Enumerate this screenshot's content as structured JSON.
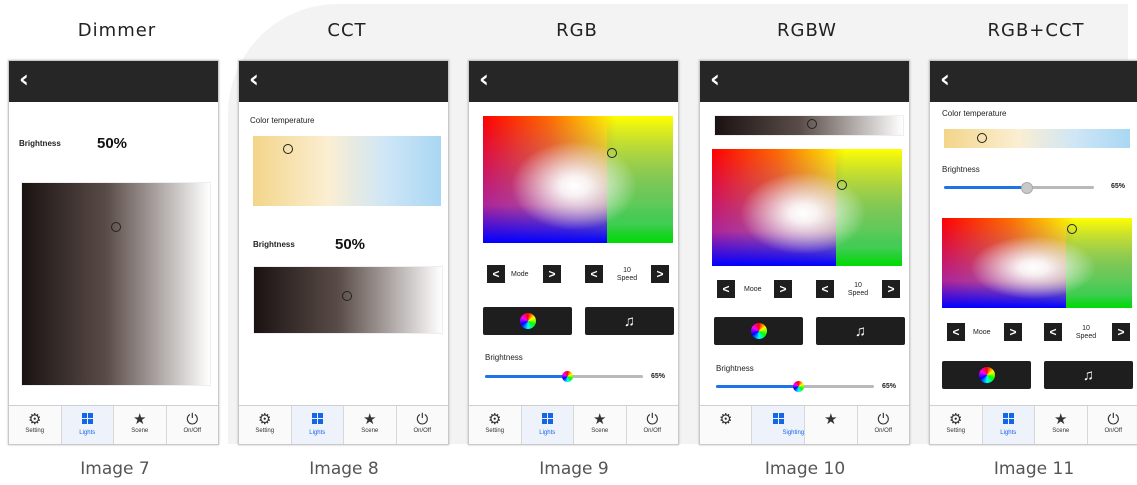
{
  "titles": [
    "Dimmer",
    "CCT",
    "RGB",
    "RGBW",
    "RGB+CCT"
  ],
  "captions": [
    "Image 7",
    "Image 8",
    "Image 9",
    "Image 10",
    "Image 11"
  ],
  "icons": {
    "back": "‹",
    "back_name": "chevron-left-icon"
  },
  "labels": {
    "brightness": "Brightness",
    "color_temperature": "Color temperature",
    "mode": "Mode",
    "mode_alt": "Mooe",
    "speed": "Speed",
    "speed_value": "10"
  },
  "values": {
    "dimmer_pct": "50%",
    "cct_pct": "50%",
    "rgb_pct": "65%",
    "rgbw_pct": "65%",
    "rgbcct_pct": "65%"
  },
  "levels": {
    "rgb": 0.65,
    "rgbw": 0.65,
    "rgbcct": 0.65
  },
  "nav": {
    "setting": "Setting",
    "lights": "Lights",
    "scene": "Scene",
    "onoff": "On/Off",
    "rgbw_overlap": "Sighting"
  },
  "colors": {
    "topbar": "#262626",
    "accent": "#1565e8"
  }
}
